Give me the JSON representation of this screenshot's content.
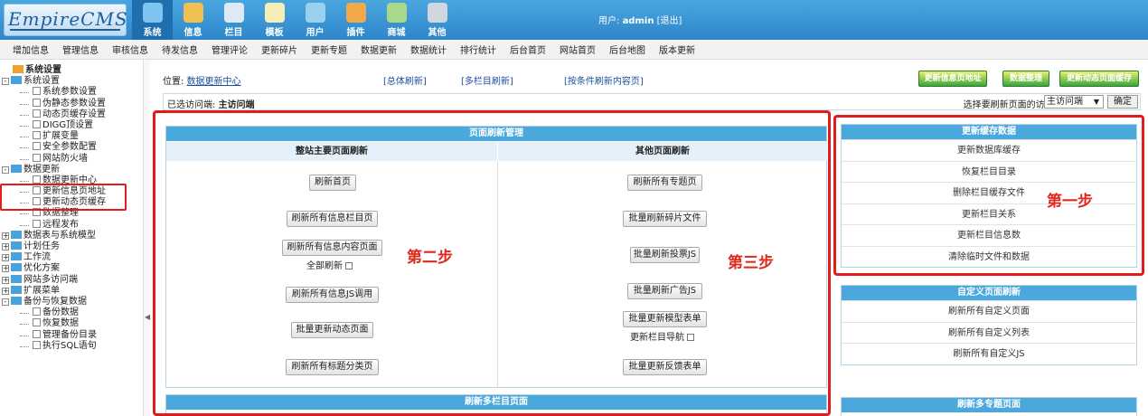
{
  "app": {
    "logo": "EmpireCMS"
  },
  "nav": [
    {
      "label": "系统",
      "icon": "globe-icon",
      "color": "#7fc3f0",
      "active": true
    },
    {
      "label": "信息",
      "icon": "pencil-icon",
      "color": "#f0c050"
    },
    {
      "label": "栏目",
      "icon": "folder-icon",
      "color": "#dfe9f4"
    },
    {
      "label": "模板",
      "icon": "window-icon",
      "color": "#f6ecb6"
    },
    {
      "label": "用户",
      "icon": "user-icon",
      "color": "#9ad0ee"
    },
    {
      "label": "插件",
      "icon": "tools-icon",
      "color": "#f2a94a"
    },
    {
      "label": "商城",
      "icon": "store-icon",
      "color": "#a8d88c"
    },
    {
      "label": "其他",
      "icon": "gear-icon",
      "color": "#cfd6dd"
    }
  ],
  "user": {
    "prefix": "用户:",
    "name": "admin",
    "logout": "[退出]"
  },
  "subnav": [
    "增加信息",
    "管理信息",
    "审核信息",
    "待发信息",
    "管理评论",
    "更新碎片",
    "更新专题",
    "数据更新",
    "数据统计",
    "排行统计",
    "后台首页",
    "网站首页",
    "后台地图",
    "版本更新"
  ],
  "tree": [
    {
      "t": "root",
      "label": "系统设置"
    },
    {
      "t": "g",
      "label": "系统设置",
      "pm": "-"
    },
    {
      "t": "c",
      "label": "系统参数设置"
    },
    {
      "t": "c",
      "label": "伪静态参数设置"
    },
    {
      "t": "c",
      "label": "动态页缓存设置"
    },
    {
      "t": "c",
      "label": "DIGG顶设置"
    },
    {
      "t": "c",
      "label": "扩展变量"
    },
    {
      "t": "c",
      "label": "安全参数配置"
    },
    {
      "t": "c",
      "label": "网站防火墙"
    },
    {
      "t": "g",
      "label": "数据更新",
      "pm": "-"
    },
    {
      "t": "c",
      "label": "数据更新中心"
    },
    {
      "t": "c",
      "label": "更新信息页地址"
    },
    {
      "t": "c",
      "label": "更新动态页缓存"
    },
    {
      "t": "c",
      "label": "数据整理"
    },
    {
      "t": "c",
      "label": "远程发布"
    },
    {
      "t": "g",
      "label": "数据表与系统模型",
      "pm": "+"
    },
    {
      "t": "g",
      "label": "计划任务",
      "pm": "+"
    },
    {
      "t": "g",
      "label": "工作流",
      "pm": "+"
    },
    {
      "t": "g",
      "label": "优化方案",
      "pm": "+"
    },
    {
      "t": "g",
      "label": "网站多访问端",
      "pm": "+"
    },
    {
      "t": "g",
      "label": "扩展菜单",
      "pm": "+"
    },
    {
      "t": "g",
      "label": "备份与恢复数据",
      "pm": "-"
    },
    {
      "t": "c",
      "label": "备份数据"
    },
    {
      "t": "c",
      "label": "恢复数据"
    },
    {
      "t": "c",
      "label": "管理备份目录"
    },
    {
      "t": "c",
      "label": "执行SQL语句"
    }
  ],
  "location": {
    "prefix": "位置:",
    "link": "数据更新中心"
  },
  "toplinks": [
    "[总体刷新]",
    "[多栏目刷新]",
    "[按条件刷新内容页]"
  ],
  "actions": [
    "更新信息页地址",
    "数据整理",
    "更新动态页面缓存"
  ],
  "access": {
    "label": "已选访问端:",
    "value": "主访问端",
    "choose": "选择要刷新页面的访问端:",
    "selected": "主访问端",
    "confirm": "确定"
  },
  "main": {
    "title": "页面刷新管理",
    "left_header": "整站主要页面刷新",
    "right_header": "其他页面刷新",
    "left_buttons": [
      "刷新首页",
      "刷新所有信息栏目页",
      "刷新所有信息内容页面",
      "刷新所有信息JS调用",
      "批量更新动态页面",
      "刷新所有标题分类页"
    ],
    "full_refresh": "全部刷新",
    "right_buttons": [
      "刷新所有专题页",
      "批量刷新碎片文件",
      "批量刷新投票JS",
      "批量刷新广告JS",
      "批量更新模型表单",
      "批量更新反馈表单"
    ],
    "update_nav": "更新栏目导航",
    "bottom_title": "刷新多栏目页面"
  },
  "cache": {
    "title": "更新缓存数据",
    "items": [
      "更新数据库缓存",
      "恢复栏目目录",
      "删除栏目缓存文件",
      "更新栏目关系",
      "更新栏目信息数",
      "清除临时文件和数据"
    ]
  },
  "custom": {
    "title": "自定义页面刷新",
    "items": [
      "刷新所有自定义页面",
      "刷新所有自定义列表",
      "刷新所有自定义JS"
    ]
  },
  "topic": {
    "title": "刷新多专题页面"
  },
  "annotations": {
    "step1": "第一步",
    "step2": "第二步",
    "step3": "第三步"
  }
}
